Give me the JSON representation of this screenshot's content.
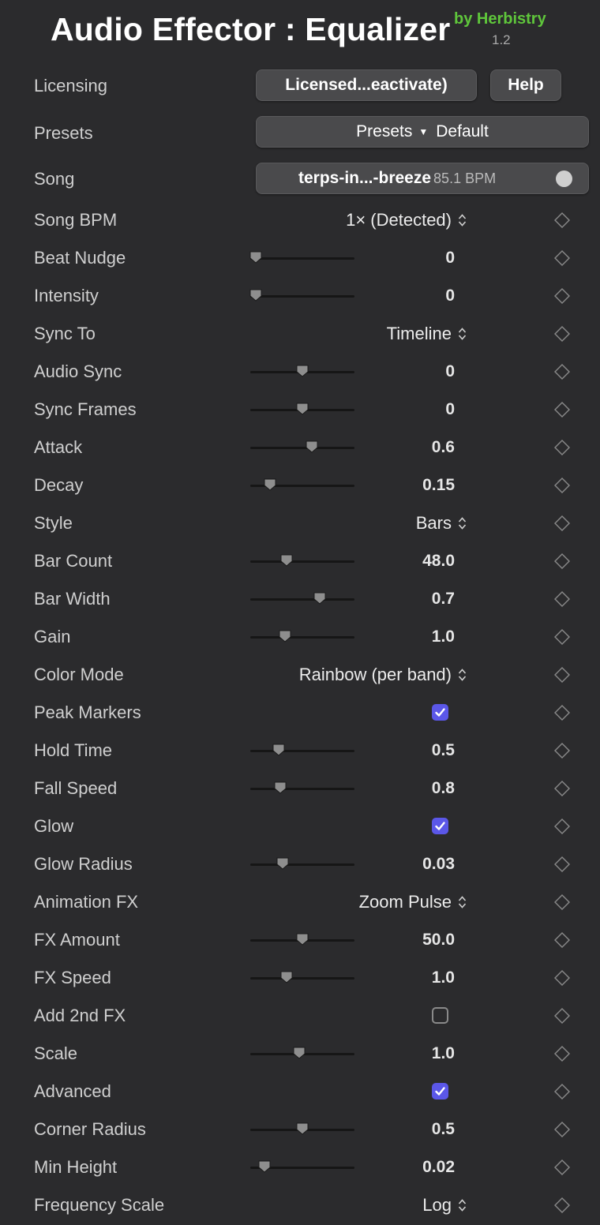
{
  "header": {
    "title": "Audio Effector : Equalizer",
    "by": "by Herbistry",
    "version": "1.2"
  },
  "licensing": {
    "label": "Licensing",
    "button": "Licensed...eactivate)",
    "help": "Help"
  },
  "presets": {
    "label": "Presets",
    "menu": "Presets",
    "value": "Default"
  },
  "song": {
    "label": "Song",
    "name": "terps-in...-breeze",
    "bpm": "85.1 BPM"
  },
  "params": [
    {
      "label": "Song BPM",
      "type": "popup",
      "value": "1× (Detected)"
    },
    {
      "label": "Beat Nudge",
      "type": "slider",
      "value": "0",
      "fraction": 0.05
    },
    {
      "label": "Intensity",
      "type": "slider",
      "value": "0",
      "fraction": 0.05
    },
    {
      "label": "Sync To",
      "type": "popup",
      "value": "Timeline"
    },
    {
      "label": "Audio Sync",
      "type": "slider",
      "value": "0",
      "fraction": 0.5
    },
    {
      "label": "Sync Frames",
      "type": "slider",
      "value": "0",
      "fraction": 0.5
    },
    {
      "label": "Attack",
      "type": "slider",
      "value": "0.6",
      "fraction": 0.59
    },
    {
      "label": "Decay",
      "type": "slider",
      "value": "0.15",
      "fraction": 0.19
    },
    {
      "label": "Style",
      "type": "popup",
      "value": "Bars"
    },
    {
      "label": "Bar Count",
      "type": "slider",
      "value": "48.0",
      "fraction": 0.35
    },
    {
      "label": "Bar Width",
      "type": "slider",
      "value": "0.7",
      "fraction": 0.67
    },
    {
      "label": "Gain",
      "type": "slider",
      "value": "1.0",
      "fraction": 0.33
    },
    {
      "label": "Color Mode",
      "type": "popup",
      "value": "Rainbow (per band)"
    },
    {
      "label": "Peak Markers",
      "type": "checkbox",
      "checked": true
    },
    {
      "label": "Hold Time",
      "type": "slider",
      "value": "0.5",
      "fraction": 0.27
    },
    {
      "label": "Fall Speed",
      "type": "slider",
      "value": "0.8",
      "fraction": 0.29
    },
    {
      "label": "Glow",
      "type": "checkbox",
      "checked": true
    },
    {
      "label": "Glow Radius",
      "type": "slider",
      "value": "0.03",
      "fraction": 0.31
    },
    {
      "label": "Animation FX",
      "type": "popup",
      "value": "Zoom Pulse"
    },
    {
      "label": "FX Amount",
      "type": "slider",
      "value": "50.0",
      "fraction": 0.5
    },
    {
      "label": "FX Speed",
      "type": "slider",
      "value": "1.0",
      "fraction": 0.35
    },
    {
      "label": "Add 2nd FX",
      "type": "checkbox",
      "checked": false
    },
    {
      "label": "Scale",
      "type": "slider",
      "value": "1.0",
      "fraction": 0.47
    },
    {
      "label": "Advanced",
      "type": "checkbox",
      "checked": true
    },
    {
      "label": "Corner Radius",
      "type": "slider",
      "value": "0.5",
      "fraction": 0.5
    },
    {
      "label": "Min Height",
      "type": "slider",
      "value": "0.02",
      "fraction": 0.14
    },
    {
      "label": "Frequency Scale",
      "type": "popup",
      "value": "Log"
    }
  ],
  "colors": {
    "background": "#2b2b2d",
    "accent_green": "#5fc63b",
    "checkbox_accent": "#5b57e8",
    "button": "#4a4a4c"
  }
}
